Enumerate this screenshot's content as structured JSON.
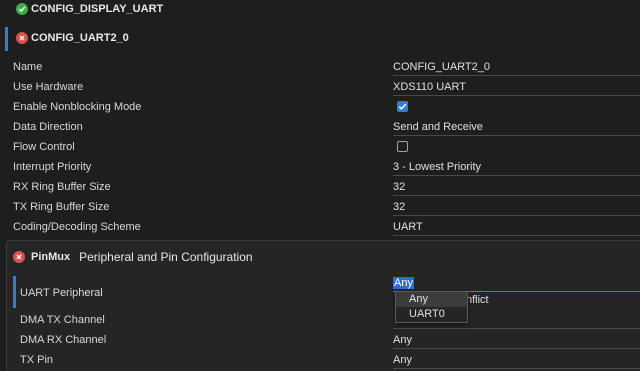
{
  "headers": {
    "display_uart": "CONFIG_DISPLAY_UART",
    "uart2": "CONFIG_UART2_0"
  },
  "rows": [
    {
      "label": "Name",
      "value": "CONFIG_UART2_0"
    },
    {
      "label": "Use Hardware",
      "value": "XDS110 UART"
    },
    {
      "label": "Enable Nonblocking Mode",
      "checked": true
    },
    {
      "label": "Data Direction",
      "value": "Send and Receive"
    },
    {
      "label": "Flow Control",
      "checked": false
    },
    {
      "label": "Interrupt Priority",
      "value": "3 - Lowest Priority"
    },
    {
      "label": "RX Ring Buffer Size",
      "value": "32"
    },
    {
      "label": "TX Ring Buffer Size",
      "value": "32"
    },
    {
      "label": "Coding/Decoding Scheme",
      "value": "UART"
    }
  ],
  "pinmux": {
    "tag": "PinMux",
    "title": "Peripheral and Pin Configuration",
    "uart_peripheral": {
      "label": "UART Peripheral",
      "value": "Any",
      "hint": "nflict"
    },
    "dropdown_options": [
      "Any",
      "UART0"
    ],
    "dma_tx": {
      "label": "DMA TX Channel"
    },
    "dma_rx": {
      "label": "DMA RX Channel",
      "value": "Any"
    },
    "tx_pin": {
      "label": "TX Pin",
      "value": "Any"
    }
  },
  "colors": {
    "accent": "#2f7fd6",
    "ok": "#3fae49",
    "error": "#d9534f"
  }
}
